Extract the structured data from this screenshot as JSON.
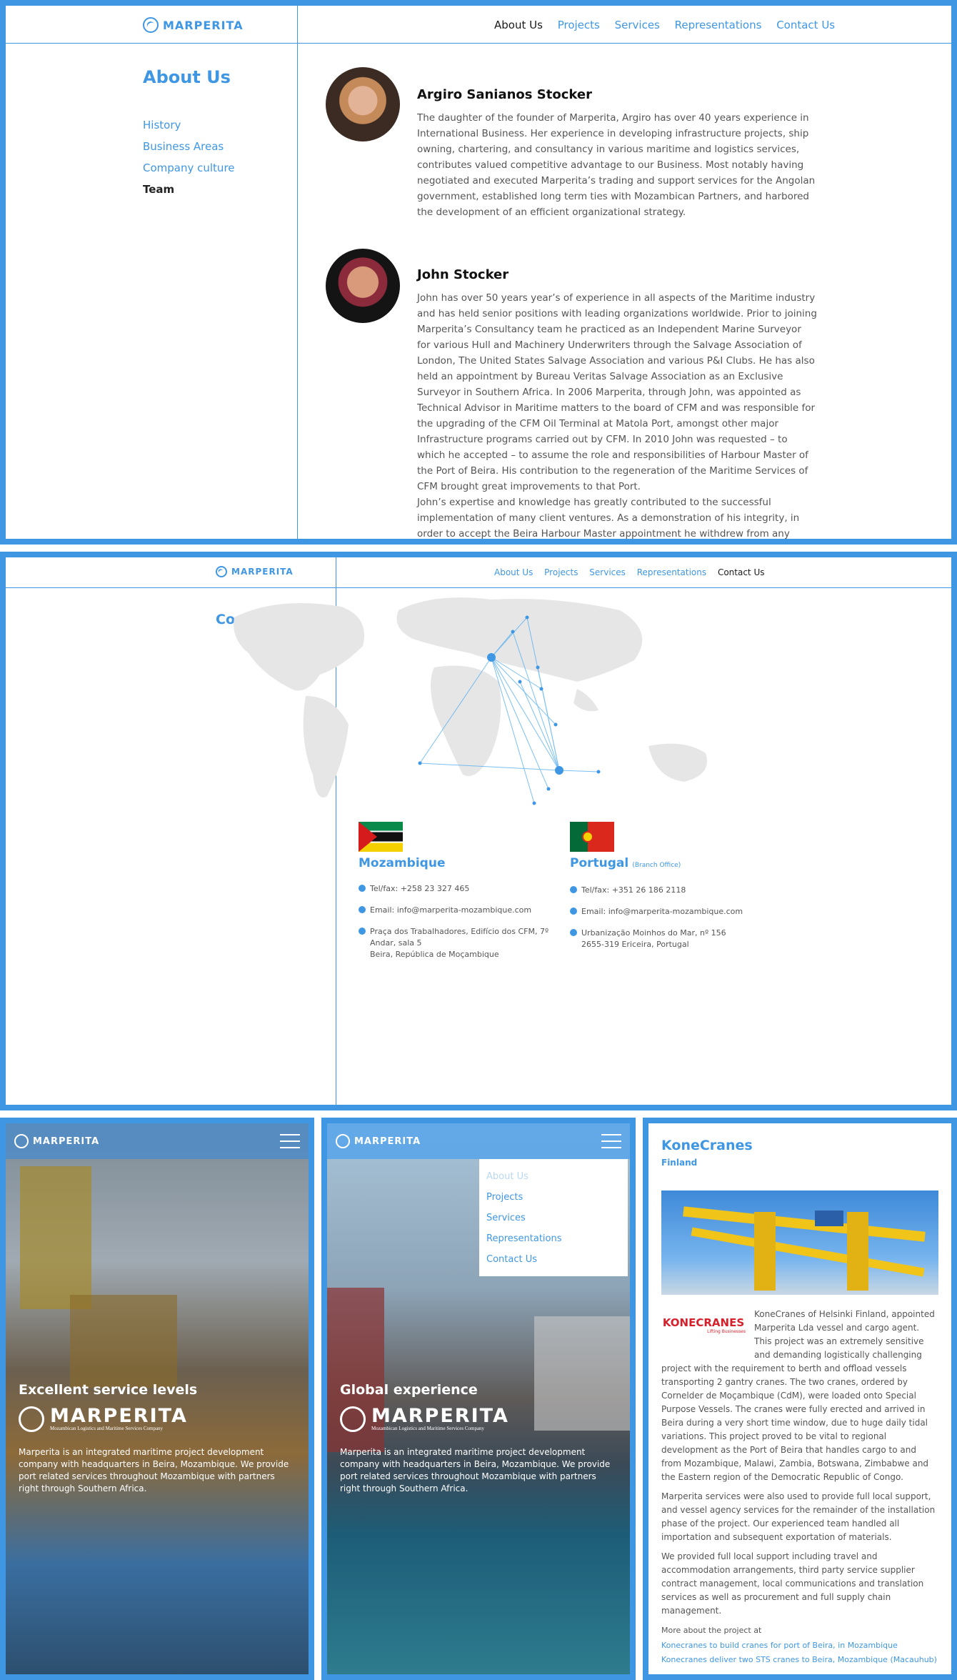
{
  "brand": {
    "name": "MARPERITA"
  },
  "desktop_nav": [
    "About Us",
    "Projects",
    "Services",
    "Representations",
    "Contact Us"
  ],
  "about": {
    "title": "About Us",
    "side": [
      "History",
      "Business Areas",
      "Company culture",
      "Team"
    ],
    "people": [
      {
        "name": "Argiro Sanianos Stocker",
        "bio": "The daughter of the founder of Marperita, Argiro has over 40 years experience in International Business. Her experience in developing infrastructure projects, ship owning, chartering, and consultancy in various maritime and logistics services, contributes valued competitive advantage to our Business. Most notably having negotiated and executed Marperita’s trading and support services for the Angolan government, established long term ties with Mozambican Partners, and harbored the development of an efficient organizational strategy."
      },
      {
        "name": "John Stocker",
        "bio": "John has over 50 years year’s of experience in all aspects of the Maritime industry and has held senior positions with leading organizations worldwide. Prior to joining Marperita’s Consultancy team he practiced as an Independent Marine Surveyor for various Hull and Machinery Underwriters through the Salvage Association of London, The United States Salvage Association and various P&I Clubs. He has also held an appointment by Bureau Veritas Salvage Association as an Exclusive Surveyor in Southern Africa. In 2006 Marperita, through John, was appointed as Technical Advisor in Maritime matters to the board of CFM and was responsible for the upgrading of the CFM Oil Terminal at Matola Port, amongst other major Infrastructure programs carried out by CFM. In 2010 John was requested – to which he accepted – to assume the role and responsibilities of Harbour Master of the Port of Beira. His contribution to the regeneration of the Maritime Services of CFM brought great improvements to that Port.",
        "bio2": "John’s expertise and knowledge has greatly contributed to the successful implementation of many client ventures. As a demonstration of his integrity, in order to accept the Beira Harbour Master appointment he withdrew from any"
      }
    ]
  },
  "contact": {
    "title": "Contact Us",
    "offices": [
      {
        "country": "Mozambique",
        "note": "",
        "tel": "Tel/fax: +258 23 327 465",
        "email": "Email: info@marperita-mozambique.com",
        "addr1": "Praça dos Trabalhadores, Edifício dos CFM, 7º",
        "addr2": "Andar, sala 5",
        "addr3": "Beira, República de Moçambique"
      },
      {
        "country": "Portugal",
        "note": "(Branch Office)",
        "tel": "Tel/fax: +351 26 186 2118",
        "email": "Email: info@marperita-mozambique.com",
        "addr1": "Urbanização Moinhos do Mar, nº 156",
        "addr2": "2655-319  Ericeira, Portugal",
        "addr3": ""
      }
    ]
  },
  "mobile1": {
    "heading": "Excellent service levels",
    "logo_sub": "Mozambican Logistics and Maritime Services Company",
    "text": "Marperita is an integrated maritime project development company with headquarters in Beira, Mozambique. We provide port related services throughout Mozambique with partners right through Southern Africa."
  },
  "mobile2": {
    "heading": "Global experience",
    "menu": [
      "About Us",
      "Projects",
      "Services",
      "Representations",
      "Contact Us"
    ]
  },
  "konecranes": {
    "title": "KoneCranes",
    "sub": "Finland",
    "logo_text": "KONECRANES",
    "logo_tag": "Lifting Businesses",
    "p1": "KoneCranes of Helsinki Finland, appointed Marperita Lda vessel and cargo agent. This project was an extremely sensitive and demanding logistically challenging project with the requirement to berth and offload vessels transporting 2 gantry cranes. The two cranes, ordered by Cornelder de Moçambique (CdM), were loaded onto Special Purpose Vessels. The cranes were fully erected and arrived in Beira during a very short time window, due to huge daily tidal variations. This project proved to be vital to regional development as the Port of Beira that handles cargo to and from Mozambique, Malawi, Zambia, Botswana, Zimbabwe and the Eastern region of the Democratic Republic of Congo.",
    "p2": "Marperita services were also used to provide full local support, and vessel agency services for the remainder of the installation phase of the project. Our experienced team handled all importation and subsequent exportation of materials.",
    "p3": "We provided full local support including travel and accommodation arrangements, third party service supplier contract management, local communications and translation services as well as procurement and full supply chain management.",
    "more": "More about the project at",
    "links": [
      "Konecranes to build cranes for port of Beira, in Mozambique",
      "Konecranes deliver two STS cranes to Beira, Mozambique (Macauhub)"
    ]
  },
  "colors": {
    "accent": "#3f97e4"
  }
}
